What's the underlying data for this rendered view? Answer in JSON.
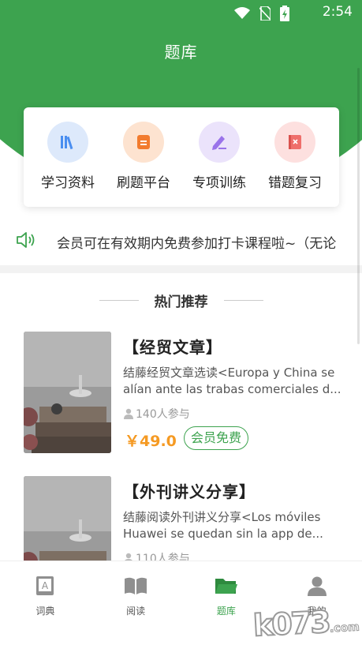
{
  "colors": {
    "brand_green": "#3da34f",
    "price_orange": "#f59a23"
  },
  "status_bar": {
    "time": "2:54",
    "icons": [
      "wifi-icon",
      "no-sim-icon",
      "battery-charging-icon"
    ]
  },
  "header": {
    "title": "题库"
  },
  "features": [
    {
      "label": "学习资料",
      "icon": "books-icon",
      "bg": "#dde9fb",
      "fg": "#4a8ef0"
    },
    {
      "label": "刷题平台",
      "icon": "document-icon",
      "bg": "#fde3d0",
      "fg": "#f27b2e"
    },
    {
      "label": "专项训练",
      "icon": "edit-icon",
      "bg": "#ebe3fb",
      "fg": "#9a73ea"
    },
    {
      "label": "错题复习",
      "icon": "wrong-book-icon",
      "bg": "#fde0df",
      "fg": "#ef6f6b"
    }
  ],
  "notice": {
    "text": "会员可在有效期内免费参加打卡课程啦~（无论",
    "icon": "speaker-icon"
  },
  "section": {
    "title": "热门推荐"
  },
  "courses": [
    {
      "title": "【经贸文章】",
      "desc": "结藤经贸文章选读<Europa y China se alían ante las trabas comerciales d...",
      "participants": "140人参与",
      "price": "￥49.0",
      "badge": "会员免费"
    },
    {
      "title": "【外刊讲义分享】",
      "desc": "结藤阅读外刊讲义分享<Los móviles Huawei se quedan sin la app de...",
      "participants": "110人参与"
    }
  ],
  "bottom_nav": [
    {
      "label": "词典",
      "icon": "dictionary-icon",
      "active": false
    },
    {
      "label": "阅读",
      "icon": "book-open-icon",
      "active": false
    },
    {
      "label": "题库",
      "icon": "folder-icon",
      "active": true
    },
    {
      "label": "我的",
      "icon": "profile-icon",
      "active": false
    }
  ],
  "watermark": {
    "text": "k073",
    "suffix": ".com"
  }
}
